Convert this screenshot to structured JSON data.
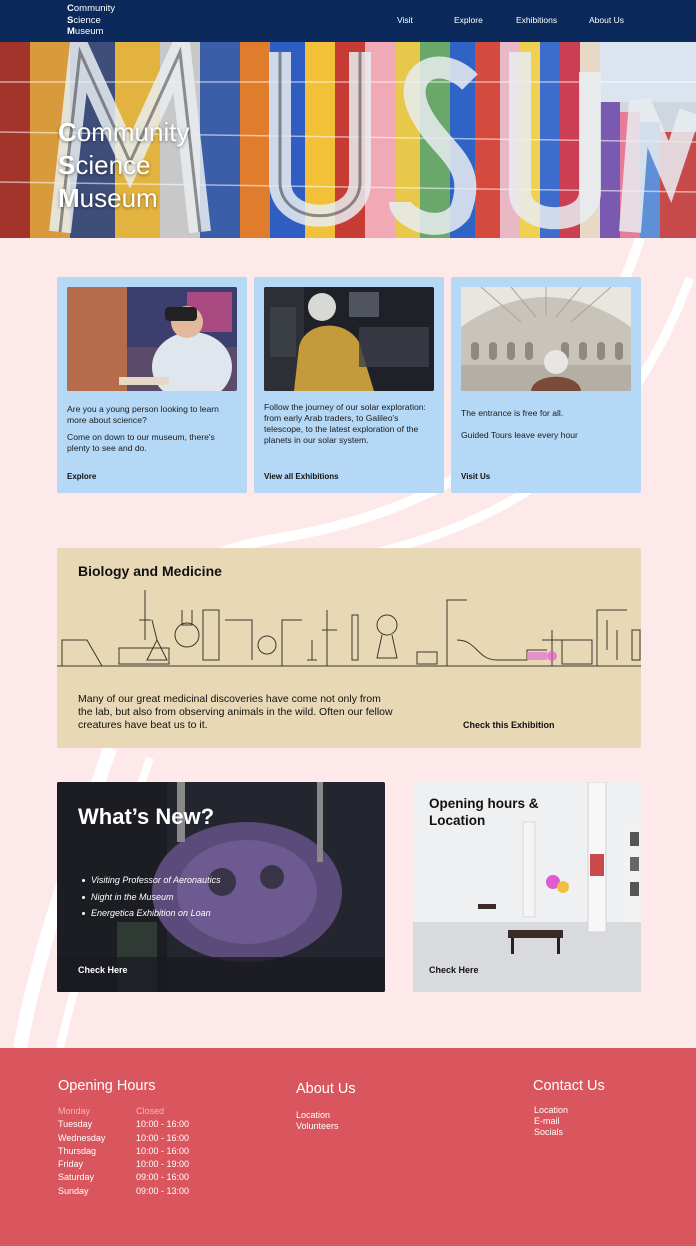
{
  "nav": {
    "logo_lines": [
      {
        "initial": "C",
        "rest": "ommunity"
      },
      {
        "initial": "S",
        "rest": "cience"
      },
      {
        "initial": "M",
        "rest": "useum"
      }
    ],
    "links": [
      "Visit",
      "Explore",
      "Exhibitions",
      "About Us"
    ]
  },
  "hero": {
    "title_lines": [
      {
        "initial": "C",
        "rest": "ommunity"
      },
      {
        "initial": "S",
        "rest": "cience"
      },
      {
        "initial": "M",
        "rest": "useum"
      }
    ]
  },
  "cards": [
    {
      "paragraphs": [
        "Are you a young person looking to learn more about science?",
        "Come on down to our museum, there's plenty to see and do."
      ],
      "link": "Explore"
    },
    {
      "paragraphs": [
        "Follow the journey of our solar exploration: from early Arab traders, to Galileo's telescope, to the latest exploration of the planets in our solar system."
      ],
      "link": "View all Exhibitions"
    },
    {
      "paragraphs": [
        "The entrance is free for all.",
        "Guided Tours leave every hour"
      ],
      "link": "Visit Us"
    }
  ],
  "biology": {
    "title": "Biology and Medicine",
    "text": "Many of our great medicinal discoveries have come not only from the lab, but also from observing animals in the wild. Often our fellow creatures have beat us to it.",
    "link": "Check this Exhibition"
  },
  "whats_new": {
    "title": "What’s New?",
    "items": [
      "Visiting Professor of Aeronautics",
      "Night in the Museum",
      "Energetica Exhibition on Loan"
    ],
    "link": "Check Here"
  },
  "hours_card": {
    "title": "Opening hours & Location",
    "link": "Check Here"
  },
  "footer": {
    "hours_heading": "Opening Hours",
    "hours": [
      {
        "day": "Monday",
        "time": "Closed"
      },
      {
        "day": "Tuesday",
        "time": "10:00 - 16:00"
      },
      {
        "day": "Wednesday",
        "time": "10:00 - 16:00"
      },
      {
        "day": "Thursdag",
        "time": "10:00 - 16:00"
      },
      {
        "day": "Friday",
        "time": "10:00 - 19:00"
      },
      {
        "day": "Saturday",
        "time": "09:00 - 16:00"
      },
      {
        "day": "Sunday",
        "time": "09:00 - 13:00"
      }
    ],
    "about_heading": "About Us",
    "about_links": [
      "Location",
      "Volunteers"
    ],
    "contact_heading": "Contact Us",
    "contact_links": [
      "Location",
      "E-mail",
      "Socials"
    ]
  },
  "colors": {
    "nav_bg": "#0b2a5b",
    "page_bg": "#fde9ea",
    "card_bg": "#b5d8f7",
    "bio_bg": "#e8d8b5",
    "footer_bg": "#d9565e"
  }
}
